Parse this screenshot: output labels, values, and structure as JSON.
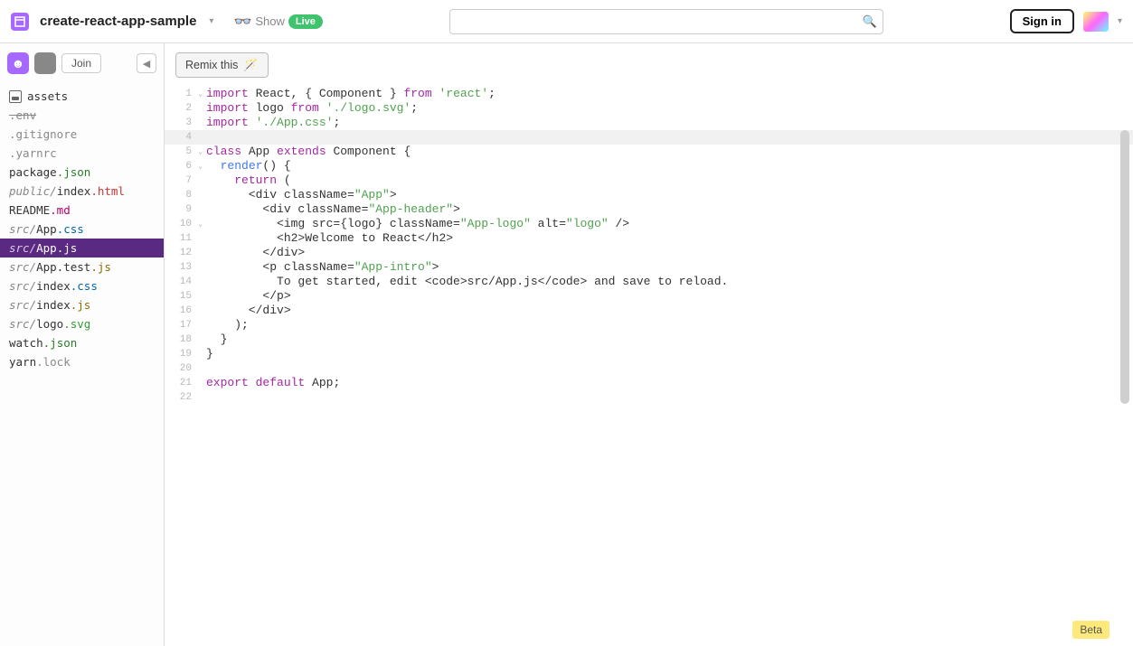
{
  "header": {
    "project_name": "create-react-app-sample",
    "show_label": "Show",
    "live_label": "Live",
    "signin_label": "Sign in",
    "search_placeholder": ""
  },
  "sidebar": {
    "join_label": "Join",
    "assets_label": "assets",
    "files": [
      {
        "prefix": "",
        "name": ".env",
        "ext": "",
        "style": "strike dotfile"
      },
      {
        "prefix": "",
        "name": ".gitignore",
        "ext": "",
        "style": "dotfile"
      },
      {
        "prefix": "",
        "name": ".yarnrc",
        "ext": "",
        "style": "dotfile"
      },
      {
        "prefix": "",
        "name": "package",
        "ext": ".json",
        "extcls": "ext-json"
      },
      {
        "prefix": "public/",
        "name": "index",
        "ext": ".html",
        "extcls": "ext-html"
      },
      {
        "prefix": "",
        "name": "README",
        "ext": ".md",
        "extcls": "ext-md"
      },
      {
        "prefix": "src/",
        "name": "App",
        "ext": ".css",
        "extcls": "ext-css"
      },
      {
        "prefix": "src/",
        "name": "App",
        "ext": ".js",
        "extcls": "ext-js",
        "active": true
      },
      {
        "prefix": "src/",
        "name": "App.test",
        "ext": ".js",
        "extcls": "ext-js"
      },
      {
        "prefix": "src/",
        "name": "index",
        "ext": ".css",
        "extcls": "ext-css"
      },
      {
        "prefix": "src/",
        "name": "index",
        "ext": ".js",
        "extcls": "ext-js"
      },
      {
        "prefix": "src/",
        "name": "logo",
        "ext": ".svg",
        "extcls": "ext-svg"
      },
      {
        "prefix": "",
        "name": "watch",
        "ext": ".json",
        "extcls": "ext-json"
      },
      {
        "prefix": "",
        "name": "yarn",
        "ext": ".lock",
        "extcls": "ext-lock"
      }
    ]
  },
  "editor": {
    "remix_label": "Remix this",
    "lines": [
      {
        "n": 1,
        "fold": true,
        "tokens": [
          [
            "kw",
            "import"
          ],
          [
            "plain",
            " React, { Component } "
          ],
          [
            "kw",
            "from"
          ],
          [
            "plain",
            " "
          ],
          [
            "str",
            "'react'"
          ],
          [
            "plain",
            ";"
          ]
        ]
      },
      {
        "n": 2,
        "tokens": [
          [
            "kw",
            "import"
          ],
          [
            "plain",
            " logo "
          ],
          [
            "kw",
            "from"
          ],
          [
            "plain",
            " "
          ],
          [
            "str",
            "'./logo.svg'"
          ],
          [
            "plain",
            ";"
          ]
        ]
      },
      {
        "n": 3,
        "tokens": [
          [
            "kw",
            "import"
          ],
          [
            "plain",
            " "
          ],
          [
            "str",
            "'./App.css'"
          ],
          [
            "plain",
            ";"
          ]
        ]
      },
      {
        "n": 4,
        "hl": true,
        "tokens": [
          [
            "plain",
            ""
          ]
        ]
      },
      {
        "n": 5,
        "fold": true,
        "tokens": [
          [
            "kw",
            "class"
          ],
          [
            "plain",
            " App "
          ],
          [
            "kw",
            "extends"
          ],
          [
            "plain",
            " Component {"
          ]
        ]
      },
      {
        "n": 6,
        "fold": true,
        "tokens": [
          [
            "plain",
            "  "
          ],
          [
            "def",
            "render"
          ],
          [
            "plain",
            "() {"
          ]
        ]
      },
      {
        "n": 7,
        "tokens": [
          [
            "plain",
            "    "
          ],
          [
            "kw",
            "return"
          ],
          [
            "plain",
            " ("
          ]
        ]
      },
      {
        "n": 8,
        "tokens": [
          [
            "plain",
            "      <div className="
          ],
          [
            "attrv",
            "\"App\""
          ],
          [
            "plain",
            ">"
          ]
        ]
      },
      {
        "n": 9,
        "tokens": [
          [
            "plain",
            "        <div className="
          ],
          [
            "attrv",
            "\"App-header\""
          ],
          [
            "plain",
            ">"
          ]
        ]
      },
      {
        "n": 10,
        "fold": true,
        "tokens": [
          [
            "plain",
            "          <img src={logo} className="
          ],
          [
            "attrv",
            "\"App-logo\""
          ],
          [
            "plain",
            " alt="
          ],
          [
            "attrv",
            "\"logo\""
          ],
          [
            "plain",
            " />"
          ]
        ]
      },
      {
        "n": 11,
        "tokens": [
          [
            "plain",
            "          <h2>Welcome to React</h2>"
          ]
        ]
      },
      {
        "n": 12,
        "tokens": [
          [
            "plain",
            "        </div>"
          ]
        ]
      },
      {
        "n": 13,
        "tokens": [
          [
            "plain",
            "        <p className="
          ],
          [
            "attrv",
            "\"App-intro\""
          ],
          [
            "plain",
            ">"
          ]
        ]
      },
      {
        "n": 14,
        "tokens": [
          [
            "plain",
            "          To get started, edit <code>src/App.js</code> and save to reload."
          ]
        ]
      },
      {
        "n": 15,
        "tokens": [
          [
            "plain",
            "        </p>"
          ]
        ]
      },
      {
        "n": 16,
        "tokens": [
          [
            "plain",
            "      </div>"
          ]
        ]
      },
      {
        "n": 17,
        "tokens": [
          [
            "plain",
            "    );"
          ]
        ]
      },
      {
        "n": 18,
        "tokens": [
          [
            "plain",
            "  }"
          ]
        ]
      },
      {
        "n": 19,
        "tokens": [
          [
            "plain",
            "}"
          ]
        ]
      },
      {
        "n": 20,
        "tokens": [
          [
            "plain",
            ""
          ]
        ]
      },
      {
        "n": 21,
        "tokens": [
          [
            "kw",
            "export"
          ],
          [
            "plain",
            " "
          ],
          [
            "kw",
            "default"
          ],
          [
            "plain",
            " App;"
          ]
        ]
      },
      {
        "n": 22,
        "tokens": [
          [
            "plain",
            ""
          ]
        ]
      }
    ]
  },
  "footer": {
    "beta_label": "Beta"
  }
}
